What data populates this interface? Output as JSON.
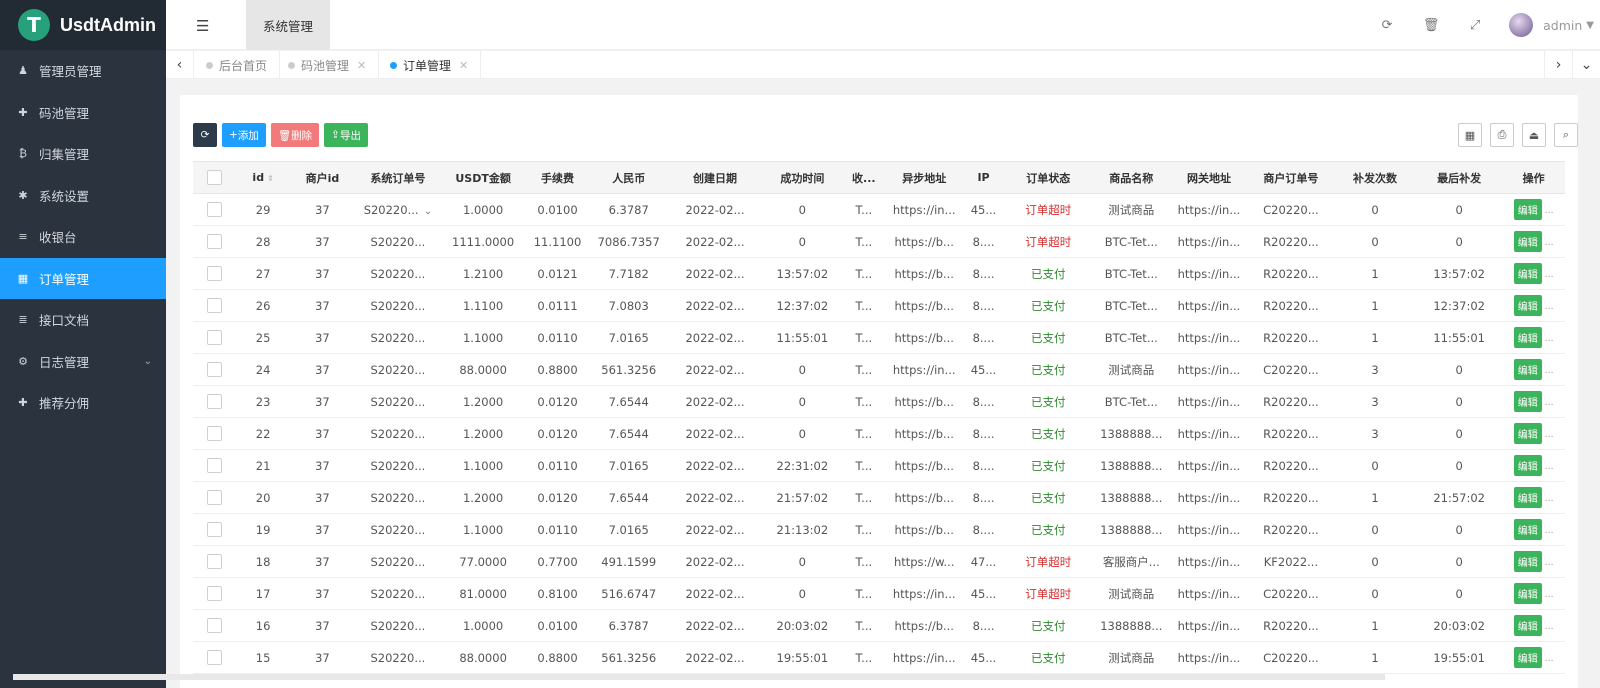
{
  "app": {
    "brand": "UsdtAdmin",
    "logo_glyph": "T"
  },
  "sidebar": {
    "items": [
      {
        "label": "管理员管理",
        "icon": "user-icon"
      },
      {
        "label": "码池管理",
        "icon": "puzzle-icon"
      },
      {
        "label": "归集管理",
        "icon": "bitcoin-icon"
      },
      {
        "label": "系统设置",
        "icon": "asterisk-icon"
      },
      {
        "label": "收银台",
        "icon": "list-icon"
      },
      {
        "label": "订单管理",
        "icon": "calculator-icon",
        "active": true
      },
      {
        "label": "接口文档",
        "icon": "align-left-icon"
      },
      {
        "label": "日志管理",
        "icon": "gear-icon",
        "has_children": true
      },
      {
        "label": "推荐分佣",
        "icon": "puzzle-icon"
      }
    ]
  },
  "header": {
    "active_module": "系统管理",
    "user": "admin"
  },
  "tabs": [
    {
      "label": "后台首页",
      "active": false
    },
    {
      "label": "码池管理",
      "active": false
    },
    {
      "label": "订单管理",
      "active": true
    }
  ],
  "toolbar": {
    "add": "添加",
    "delete": "删除",
    "export": "导出"
  },
  "table": {
    "headers": [
      "id",
      "商户id",
      "系统订单号",
      "USDT金额",
      "手续费",
      "人民币",
      "创建日期",
      "成功时间",
      "收...",
      "异步地址",
      "IP",
      "订单状态",
      "商品名称",
      "网关地址",
      "商户订单号",
      "补发次数",
      "最后补发",
      "操作"
    ],
    "edit_label": "编辑",
    "rows": [
      [
        "29",
        "37",
        "S20220...",
        "1.0000",
        "0.0100",
        "6.3787",
        "2022-02...",
        "0",
        "T...",
        "https://in...",
        "45...",
        "订单超时",
        "测试商品",
        "https://in...",
        "C20220...",
        "0",
        "0"
      ],
      [
        "28",
        "37",
        "S20220...",
        "1111.0000",
        "11.1100",
        "7086.7357",
        "2022-02...",
        "0",
        "T...",
        "https://b...",
        "8....",
        "订单超时",
        "BTC-Tet...",
        "https://in...",
        "R20220...",
        "0",
        "0"
      ],
      [
        "27",
        "37",
        "S20220...",
        "1.2100",
        "0.0121",
        "7.7182",
        "2022-02...",
        "13:57:02",
        "T...",
        "https://b...",
        "8....",
        "已支付",
        "BTC-Tet...",
        "https://in...",
        "R20220...",
        "1",
        "13:57:02"
      ],
      [
        "26",
        "37",
        "S20220...",
        "1.1100",
        "0.0111",
        "7.0803",
        "2022-02...",
        "12:37:02",
        "T...",
        "https://b...",
        "8....",
        "已支付",
        "BTC-Tet...",
        "https://in...",
        "R20220...",
        "1",
        "12:37:02"
      ],
      [
        "25",
        "37",
        "S20220...",
        "1.1000",
        "0.0110",
        "7.0165",
        "2022-02...",
        "11:55:01",
        "T...",
        "https://b...",
        "8....",
        "已支付",
        "BTC-Tet...",
        "https://in...",
        "R20220...",
        "1",
        "11:55:01"
      ],
      [
        "24",
        "37",
        "S20220...",
        "88.0000",
        "0.8800",
        "561.3256",
        "2022-02...",
        "0",
        "T...",
        "https://in...",
        "45...",
        "已支付",
        "测试商品",
        "https://in...",
        "C20220...",
        "3",
        "0"
      ],
      [
        "23",
        "37",
        "S20220...",
        "1.2000",
        "0.0120",
        "7.6544",
        "2022-02...",
        "0",
        "T...",
        "https://b...",
        "8....",
        "已支付",
        "BTC-Tet...",
        "https://in...",
        "R20220...",
        "3",
        "0"
      ],
      [
        "22",
        "37",
        "S20220...",
        "1.2000",
        "0.0120",
        "7.6544",
        "2022-02...",
        "0",
        "T...",
        "https://b...",
        "8....",
        "已支付",
        "1388888...",
        "https://in...",
        "R20220...",
        "3",
        "0"
      ],
      [
        "21",
        "37",
        "S20220...",
        "1.1000",
        "0.0110",
        "7.0165",
        "2022-02...",
        "22:31:02",
        "T...",
        "https://b...",
        "8....",
        "已支付",
        "1388888...",
        "https://in...",
        "R20220...",
        "0",
        "0"
      ],
      [
        "20",
        "37",
        "S20220...",
        "1.2000",
        "0.0120",
        "7.6544",
        "2022-02...",
        "21:57:02",
        "T...",
        "https://b...",
        "8....",
        "已支付",
        "1388888...",
        "https://in...",
        "R20220...",
        "1",
        "21:57:02"
      ],
      [
        "19",
        "37",
        "S20220...",
        "1.1000",
        "0.0110",
        "7.0165",
        "2022-02...",
        "21:13:02",
        "T...",
        "https://b...",
        "8....",
        "已支付",
        "1388888...",
        "https://in...",
        "R20220...",
        "0",
        "0"
      ],
      [
        "18",
        "37",
        "S20220...",
        "77.0000",
        "0.7700",
        "491.1599",
        "2022-02...",
        "0",
        "T...",
        "https://w...",
        "47...",
        "订单超时",
        "客服商户...",
        "https://in...",
        "KF2022...",
        "0",
        "0"
      ],
      [
        "17",
        "37",
        "S20220...",
        "81.0000",
        "0.8100",
        "516.6747",
        "2022-02...",
        "0",
        "T...",
        "https://in...",
        "45...",
        "订单超时",
        "测试商品",
        "https://in...",
        "C20220...",
        "0",
        "0"
      ],
      [
        "16",
        "37",
        "S20220...",
        "1.0000",
        "0.0100",
        "6.3787",
        "2022-02...",
        "20:03:02",
        "T...",
        "https://b...",
        "8....",
        "已支付",
        "1388888...",
        "https://in...",
        "R20220...",
        "1",
        "20:03:02"
      ],
      [
        "15",
        "37",
        "S20220...",
        "88.0000",
        "0.8800",
        "561.3256",
        "2022-02...",
        "19:55:01",
        "T...",
        "https://in...",
        "45...",
        "已支付",
        "测试商品",
        "https://in...",
        "C20220...",
        "1",
        "19:55:01"
      ]
    ]
  },
  "colors": {
    "accent": "#1e9fff",
    "sidebar_bg": "#2b333e",
    "success": "#3cb45c",
    "danger": "#f27a7a",
    "timeout_text": "#d32f2f",
    "paid_text": "#2e8b2e"
  }
}
